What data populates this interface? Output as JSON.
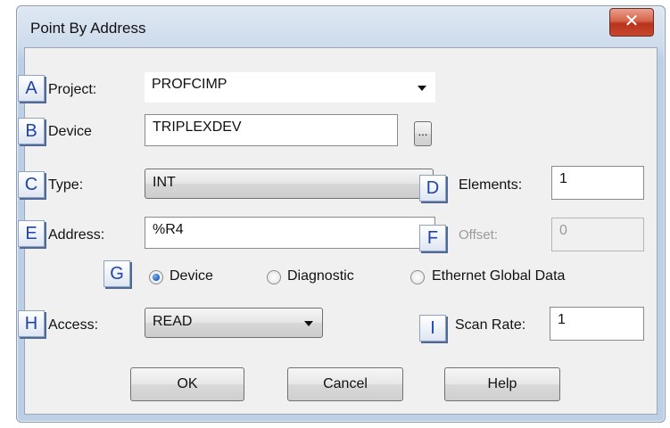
{
  "window": {
    "title": "Point By Address",
    "close_glyph": "✕"
  },
  "badges": {
    "a": "A",
    "b": "B",
    "c": "C",
    "d": "D",
    "e": "E",
    "f": "F",
    "g": "G",
    "h": "H",
    "i": "I"
  },
  "project": {
    "label": "Project:",
    "value": "PROFCIMP"
  },
  "device": {
    "label": "Device",
    "value": "TRIPLEXDEV",
    "browse_label": "..."
  },
  "type": {
    "label": "Type:",
    "value": "INT"
  },
  "elements": {
    "label": "Elements:",
    "value": "1"
  },
  "address": {
    "label": "Address:",
    "value": "%R4"
  },
  "offset": {
    "label": "Offset:",
    "value": "0"
  },
  "address_source": {
    "options": [
      "Device",
      "Diagnostic",
      "Ethernet Global Data"
    ],
    "selected": "Device"
  },
  "access": {
    "label": "Access:",
    "value": "READ"
  },
  "scan_rate": {
    "label": "Scan Rate:",
    "value": "1"
  },
  "buttons": {
    "ok": "OK",
    "cancel": "Cancel",
    "help": "Help"
  },
  "colors": {
    "badge_text": "#1f43a8",
    "close_button": "#c9482e",
    "radio_selected": "#1a5fc4"
  }
}
